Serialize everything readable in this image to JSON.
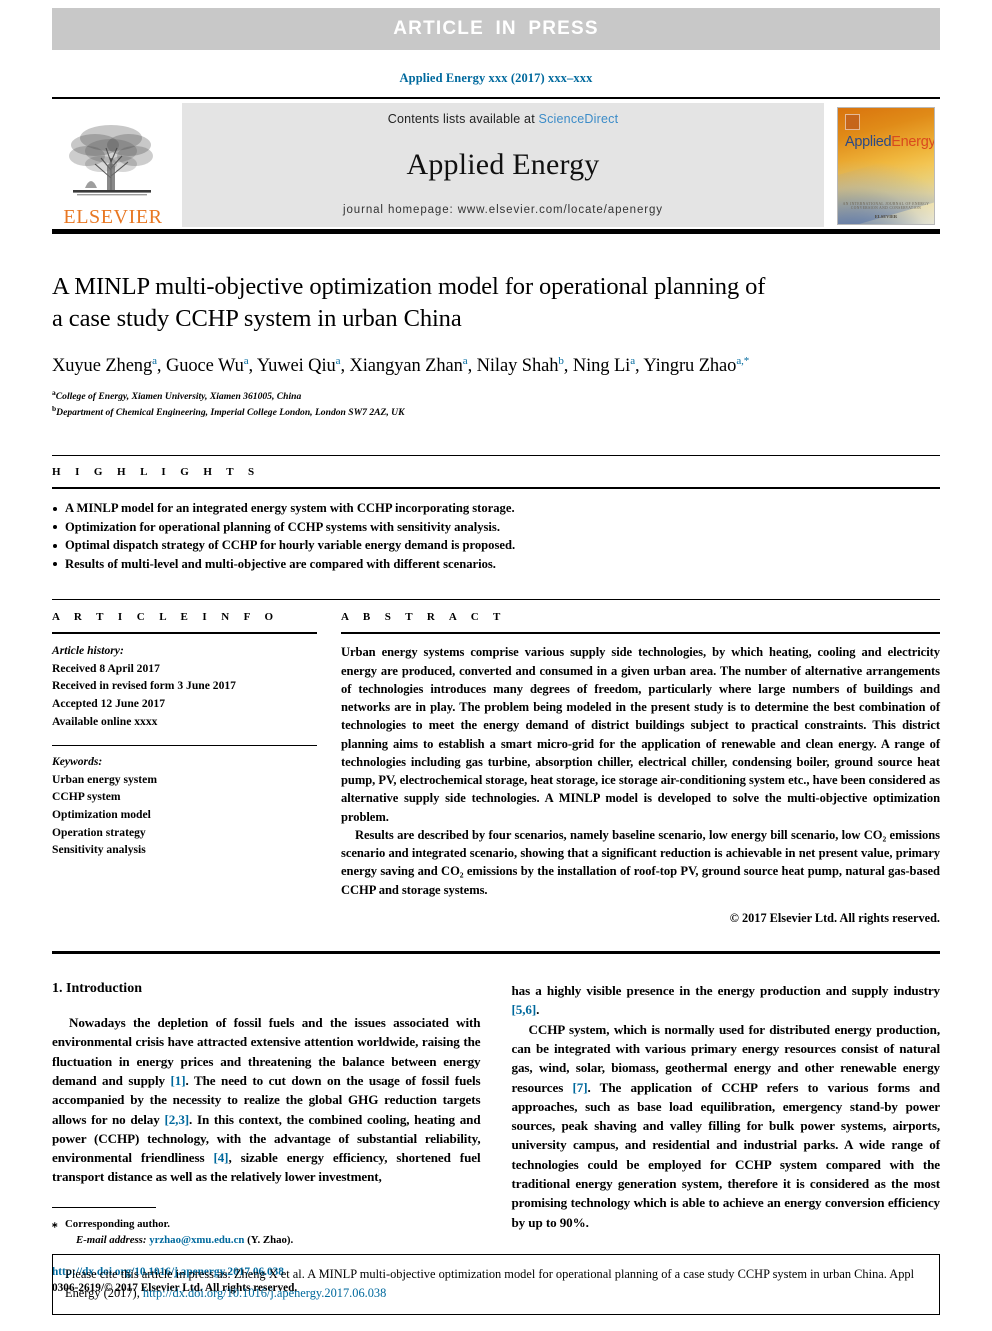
{
  "banner": {
    "text": "ARTICLE  IN  PRESS"
  },
  "running_head": "Applied Energy xxx (2017) xxx–xxx",
  "masthead": {
    "publisher_name": "ELSEVIER",
    "contents_prefix": "Contents lists available at ",
    "contents_link": "ScienceDirect",
    "journal_title": "Applied Energy",
    "homepage_line": "journal homepage: www.elsevier.com/locate/apenergy",
    "cover": {
      "title_part1": "Applied",
      "title_part2": "Energy",
      "foot_line1": "AN INTERNATIONAL JOURNAL OF ENERGY CONVERSION AND CONSERVATION",
      "foot_line2": "ELSEVIER"
    },
    "colors": {
      "link_blue": "#3c8cc8",
      "elsevier_orange": "#e87722",
      "panel_gray": "#e4e4e4"
    }
  },
  "article": {
    "title_line1": "A MINLP multi-objective optimization model for operational planning of",
    "title_line2": "a case study CCHP system in urban China",
    "authors": [
      {
        "name": "Xuyue Zheng",
        "sup": "a",
        "sep": ", "
      },
      {
        "name": "Guoce Wu",
        "sup": "a",
        "sep": ", "
      },
      {
        "name": "Yuwei Qiu",
        "sup": "a",
        "sep": ", "
      },
      {
        "name": "Xiangyan Zhan",
        "sup": "a",
        "sep": ", "
      },
      {
        "name": "Nilay Shah",
        "sup": "b",
        "sep": ", "
      },
      {
        "name": "Ning Li",
        "sup": "a",
        "sep": ", "
      },
      {
        "name": "Yingru Zhao",
        "sup": "a,*",
        "sep": ""
      }
    ],
    "affiliations": [
      {
        "marker": "a",
        "text": "College of Energy, Xiamen University, Xiamen 361005, China"
      },
      {
        "marker": "b",
        "text": "Department of Chemical Engineering, Imperial College London, London SW7 2AZ, UK"
      }
    ]
  },
  "highlights": {
    "heading": "H I G H L I G H T S",
    "items": [
      "A MINLP model for an integrated energy system with CCHP incorporating storage.",
      "Optimization for operational planning of CCHP systems with sensitivity analysis.",
      "Optimal dispatch strategy of CCHP for hourly variable energy demand is proposed.",
      "Results of multi-level and multi-objective are compared with different scenarios."
    ]
  },
  "article_info": {
    "heading": "A R T I C L E   I N F O",
    "history_label": "Article history:",
    "history_lines": [
      "Received 8 April 2017",
      "Received in revised form 3 June 2017",
      "Accepted 12 June 2017",
      "Available online xxxx"
    ],
    "keywords_label": "Keywords:",
    "keywords": [
      "Urban energy system",
      "CCHP system",
      "Optimization model",
      "Operation strategy",
      "Sensitivity analysis"
    ]
  },
  "abstract": {
    "heading": "A B S T R A C T",
    "paragraph1": "Urban energy systems comprise various supply side technologies, by which heating, cooling and electricity energy are produced, converted and consumed in a given urban area. The number of alternative arrangements of technologies introduces many degrees of freedom, particularly where large numbers of buildings and networks are in play. The problem being modeled in the present study is to determine the best combination of technologies to meet the energy demand of district buildings subject to practical constraints. This district planning aims to establish a smart micro-grid for the application of renewable and clean energy. A range of technologies including gas turbine, absorption chiller, electrical chiller, condensing boiler, ground source heat pump, PV, electrochemical storage, heat storage, ice storage air-conditioning system etc., have been considered as alternative supply side technologies. A MINLP model is developed to solve the multi-objective optimization problem.",
    "paragraph2": "Results are described by four scenarios, namely baseline scenario, low energy bill scenario, low CO₂ emissions scenario and integrated scenario, showing that a significant reduction is achievable in net present value, primary energy saving and CO₂ emissions by the installation of roof-top PV, ground source heat pump, natural gas-based CCHP and storage systems.",
    "copyright": "© 2017 Elsevier Ltd. All rights reserved."
  },
  "body": {
    "section_heading": "1. Introduction",
    "left_paragraph_pre": "Nowadays the depletion of fossil fuels and the issues associated with environmental crisis have attracted extensive attention worldwide, raising the fluctuation in energy prices and threatening the balance between energy demand and supply ",
    "left_ref1": "[1]",
    "left_paragraph_mid": ". The need to cut down on the usage of fossil fuels accompanied by the necessity to realize the global GHG reduction targets allows for no delay ",
    "left_ref2": "[2,3]",
    "left_paragraph_mid2": ". In this context, the combined cooling, heating and power (CCHP) technology, with the advantage of substantial reliability, environmental friendliness ",
    "left_ref3": "[4]",
    "left_paragraph_end": ", sizable energy efficiency, shortened fuel transport distance as well as the relatively lower investment,",
    "right_paragraph1_pre": "has a highly visible presence in the energy production and supply industry ",
    "right_ref1": "[5,6]",
    "right_paragraph1_end": ".",
    "right_paragraph2_pre": "CCHP system, which is normally used for distributed energy production, can be integrated with various primary energy resources consist of natural gas, wind, solar, biomass, geothermal energy and other renewable energy resources ",
    "right_ref2": "[7]",
    "right_paragraph2_end": ". The application of CCHP refers to various forms and approaches, such as base load equilibration, emergency stand-by power sources, peak shaving and valley filling for bulk power systems, airports, university campus, and residential and industrial parks. A wide range of technologies could be employed for CCHP system compared with the traditional energy generation system, therefore it is considered as the most promising technology which is able to achieve an energy conversion efficiency by up to 90%."
  },
  "footnote": {
    "star": "⁎",
    "corresponding": "Corresponding author.",
    "email_label": "E-mail address:",
    "email": "yrzhao@xmu.edu.cn",
    "email_suffix": "(Y. Zhao).",
    "doi": "http://dx.doi.org/10.1016/j.apenergy.2017.06.038",
    "issn": "0306-2619/© 2017 Elsevier Ltd. All rights reserved."
  },
  "citation": {
    "prefix": "Please cite this article in press as: Zheng X et al. A MINLP multi-objective optimization model for operational planning of a case study CCHP system in urban China. Appl Energy (2017), ",
    "link": "http://dx.doi.org/10.1016/j.apenergy.2017.06.038"
  }
}
